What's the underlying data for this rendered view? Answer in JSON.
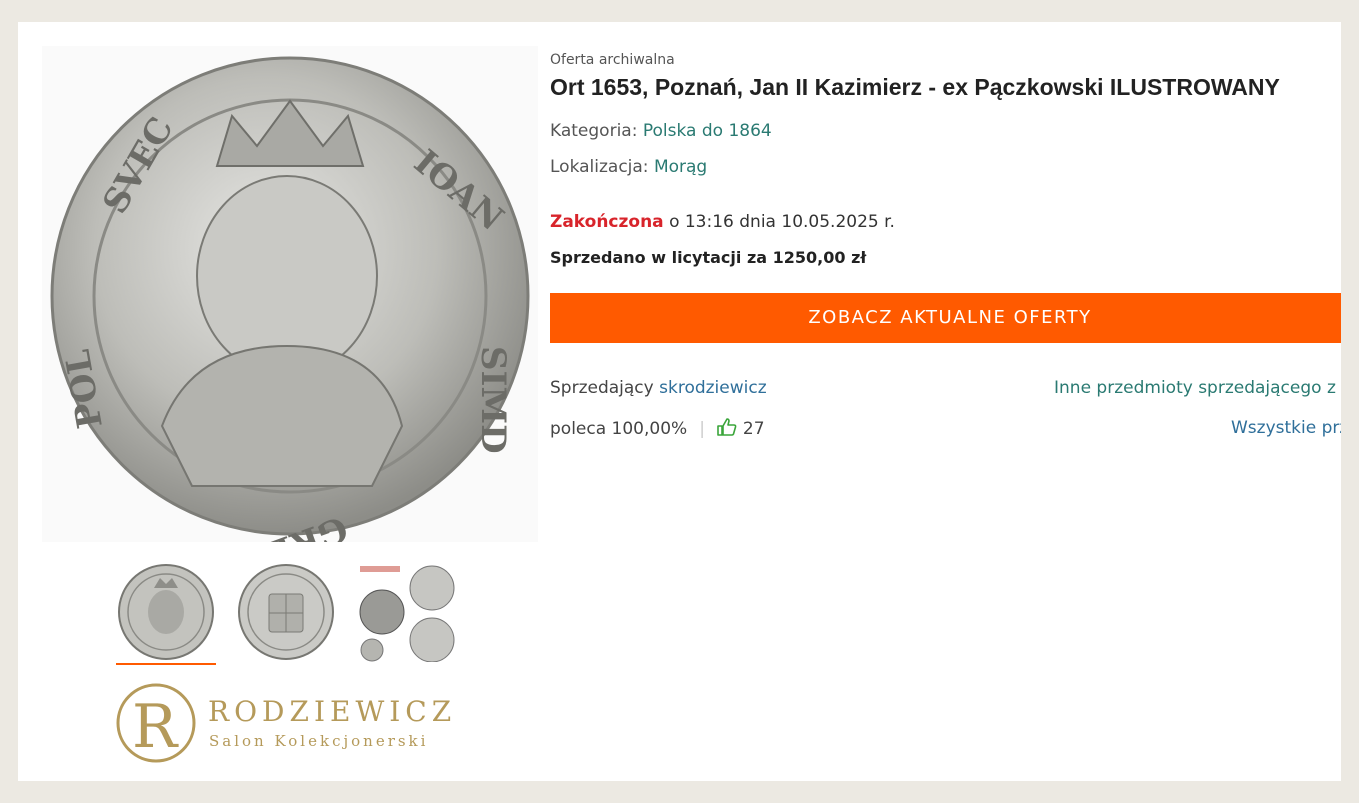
{
  "gallery": {
    "main_alt": "Ort 1653 coin obverse",
    "thumbnails": [
      {
        "name": "obverse",
        "active": true
      },
      {
        "name": "reverse",
        "active": false
      },
      {
        "name": "certificate",
        "active": false
      }
    ]
  },
  "logo": {
    "name": "RODZIEWICZ",
    "subtitle": "Salon Kolekcjonerski"
  },
  "offer": {
    "archive_label": "Oferta archiwalna",
    "title": "Ort 1653, Poznań, Jan II Kazimierz - ex Pączkowski ILUSTROWANY",
    "category_label": "Kategoria:",
    "category_value": "Polska do 1864",
    "location_label": "Lokalizacja:",
    "location_value": "Morąg",
    "status": "Zakończona",
    "ended_text": "o 13:16 dnia 10.05.2025 r.",
    "sold_text": "Sprzedano w licytacji za 1250,00 zł",
    "cta_label": "ZOBACZ AKTUALNE OFERTY"
  },
  "seller": {
    "label": "Sprzedający",
    "name": "skrodziewicz",
    "other_items_link": "Inne przedmioty sprzedającego z k",
    "recommend_text": "poleca 100,00%",
    "thumbs_count": "27",
    "all_link": "Wszystkie prz"
  },
  "colors": {
    "accent": "#ff5a00",
    "status_red": "#d8242b",
    "link_teal": "#2a7a72",
    "link_blue": "#2f6f9a",
    "gold": "#b59a5a"
  }
}
